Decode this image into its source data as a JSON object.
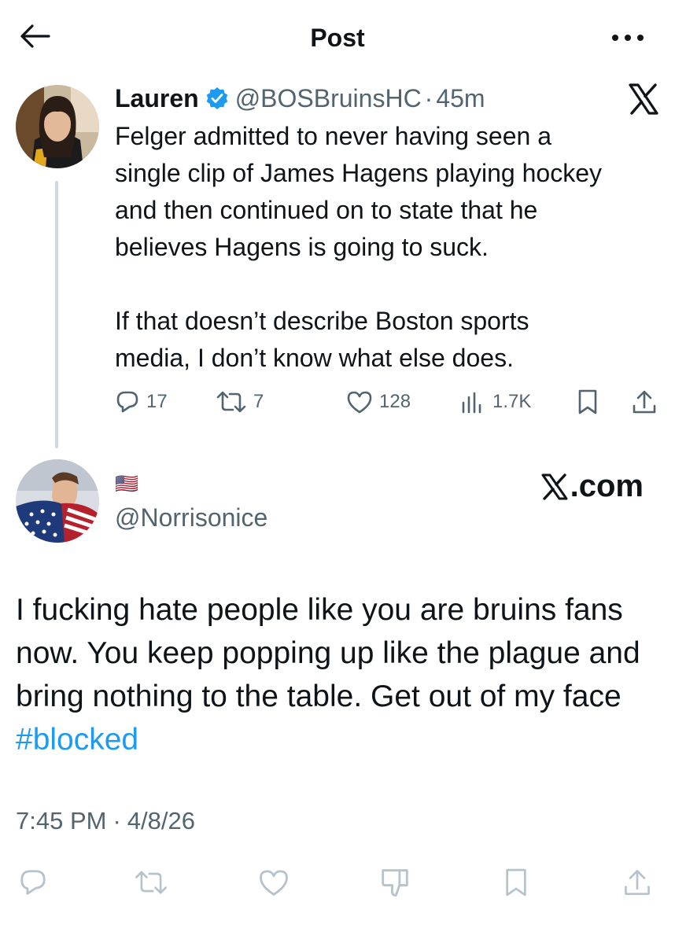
{
  "header": {
    "title": "Post"
  },
  "reply": {
    "name": "Lauren",
    "handle": "@BOSBruinsHC",
    "separator": "·",
    "time": "45m",
    "paragraphs": [
      "Felger admitted to never having seen a\nsingle clip of James Hagens playing hockey\nand then continued on to state that he\nbelieves Hagens is going to suck.",
      "If that doesn’t describe Boston sports\nmedia, I don’t know what else does."
    ],
    "stats": {
      "replies": "17",
      "reposts": "7",
      "likes": "128",
      "views": "1.7K"
    }
  },
  "main": {
    "flag": "🇺🇸",
    "handle": "@Norrisonice",
    "watermark": "X.com",
    "text": "I fucking hate people like you are bruins fans now. You keep popping up like the plague and bring nothing to the table. Get out of my face ",
    "hashtag": "#blocked",
    "time": "7:45 PM",
    "separator": "·",
    "date": "4/8/26"
  },
  "colors": {
    "accent": "#1d9bf0",
    "muted": "#536471",
    "text": "#0f1419",
    "line": "#cfd9de"
  },
  "icons": [
    "back-arrow-icon",
    "more-icon",
    "verified-badge-icon",
    "x-logo-icon",
    "reply-icon",
    "repost-icon",
    "like-icon",
    "views-icon",
    "bookmark-icon",
    "share-icon",
    "dislike-icon"
  ]
}
